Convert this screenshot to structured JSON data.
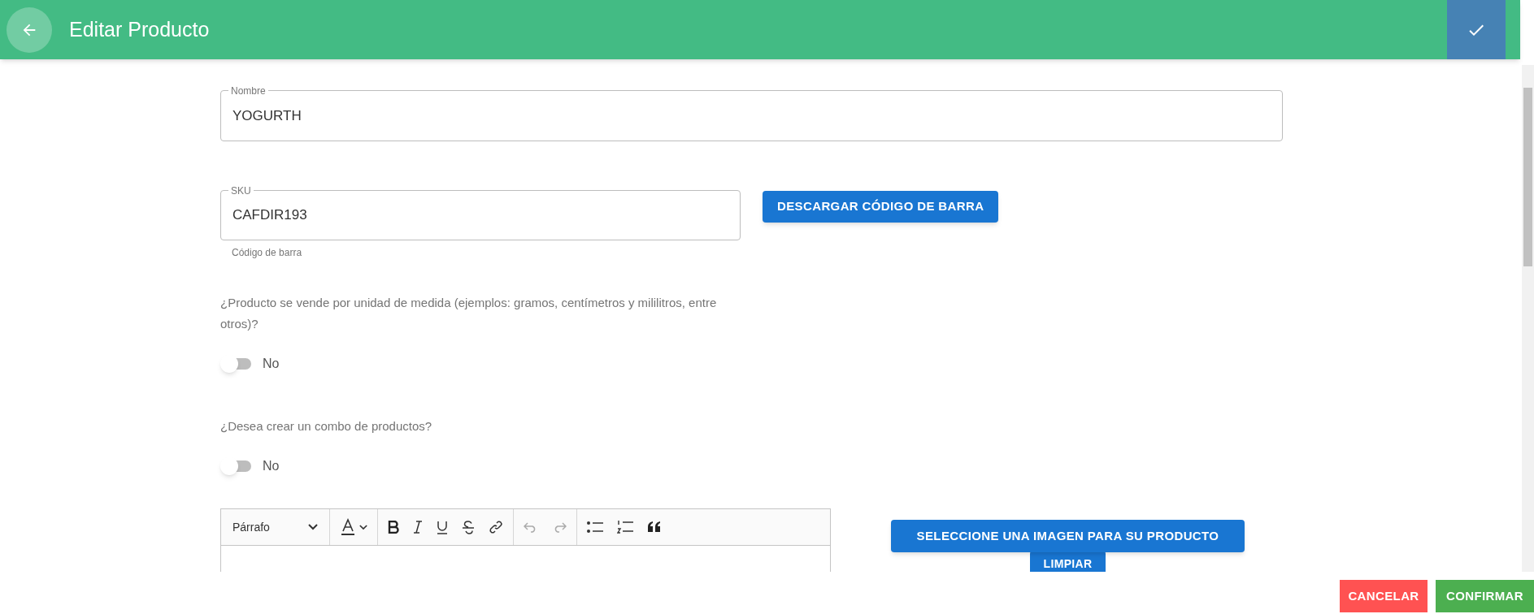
{
  "header": {
    "title": "Editar Producto"
  },
  "name_field": {
    "label": "Nombre",
    "value": "YOGURTH"
  },
  "sku_field": {
    "label": "SKU",
    "value": "CAFDIR193",
    "helper": "Código de barra"
  },
  "barcode_button": "DESCARGAR CÓDIGO DE BARRA",
  "questions": [
    {
      "label": "¿Producto se vende por unidad de medida (ejemplos: gramos, centímetros y mililitros, entre otros)?",
      "on": false,
      "state_label": "No"
    },
    {
      "label": "¿Desea crear un combo de productos?",
      "on": false,
      "state_label": "No"
    }
  ],
  "editor": {
    "block_format": "Párrafo"
  },
  "image_button": "SELECCIONE UNA IMAGEN PARA SU PRODUCTO",
  "clear_button": "LIMPIAR",
  "footer_buttons": [
    {
      "label": "CANCELAR",
      "kind": "cancel"
    },
    {
      "label": "CONFIRMAR",
      "kind": "confirm"
    }
  ]
}
